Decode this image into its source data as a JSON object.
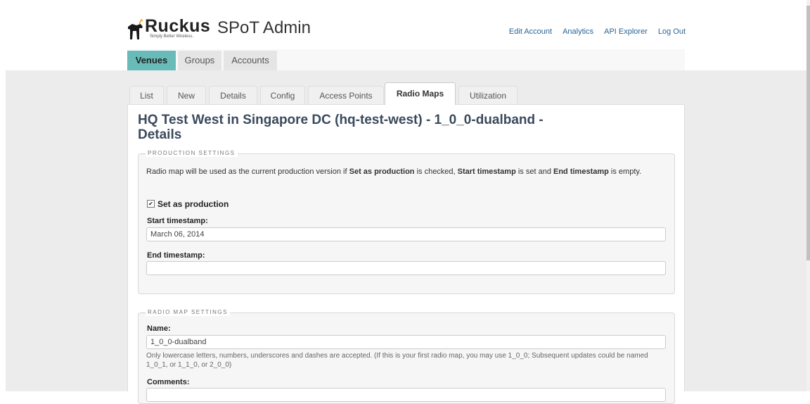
{
  "brand": {
    "logo_word": "Ruckus",
    "logo_tagline": "Simply Better Wireless.",
    "app_title": "SPoT Admin",
    "accent_color": "#68bbb9"
  },
  "top_links": [
    "Edit Account",
    "Analytics",
    "API Explorer",
    "Log Out"
  ],
  "nav_tabs": [
    {
      "label": "Venues",
      "active": true
    },
    {
      "label": "Groups",
      "active": false
    },
    {
      "label": "Accounts",
      "active": false
    }
  ],
  "content_tabs": [
    {
      "label": "List"
    },
    {
      "label": "New"
    },
    {
      "label": "Details"
    },
    {
      "label": "Config"
    },
    {
      "label": "Access Points"
    },
    {
      "label": "Radio Maps",
      "active": true
    },
    {
      "label": "Utilization"
    }
  ],
  "page_title": "HQ Test West in Singapore DC (hq-test-west) - 1_0_0-dualband - Details",
  "production": {
    "legend": "PRODUCTION SETTINGS",
    "desc_1": "Radio map will be used as the current production version if ",
    "desc_b1": "Set as production",
    "desc_2": " is checked, ",
    "desc_b2": "Start timestamp",
    "desc_3": " is set and ",
    "desc_b3": "End timestamp",
    "desc_4": " is empty.",
    "checkbox_label": "Set as production",
    "checkbox_checked": true,
    "start_label": "Start timestamp:",
    "start_value": "March 06, 2014",
    "end_label": "End timestamp:",
    "end_value": ""
  },
  "radio_map": {
    "legend": "RADIO MAP SETTINGS",
    "name_label": "Name:",
    "name_value": "1_0_0-dualband",
    "name_hint": "Only lowercase letters, numbers, underscores and dashes are accepted. (If this is your first radio map, you may use 1_0_0; Subsequent updates could be named 1_0_1, or 1_1_0, or 2_0_0)",
    "comments_label": "Comments:"
  }
}
